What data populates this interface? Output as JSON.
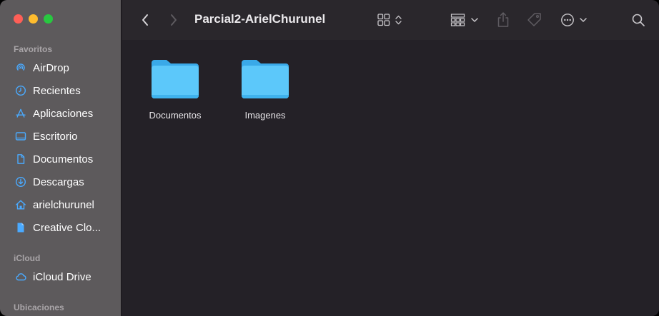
{
  "window": {
    "title": "Parcial2-ArielChurunel"
  },
  "sidebar": {
    "sections": [
      {
        "title": "Favoritos"
      },
      {
        "title": "iCloud"
      },
      {
        "title": "Ubicaciones"
      }
    ],
    "favorites": [
      {
        "label": "AirDrop",
        "icon": "airdrop-icon"
      },
      {
        "label": "Recientes",
        "icon": "clock-icon"
      },
      {
        "label": "Aplicaciones",
        "icon": "applications-icon"
      },
      {
        "label": "Escritorio",
        "icon": "desktop-icon"
      },
      {
        "label": "Documentos",
        "icon": "document-icon"
      },
      {
        "label": "Descargas",
        "icon": "download-icon"
      },
      {
        "label": "arielchurunel",
        "icon": "home-icon"
      },
      {
        "label": "Creative Clo...",
        "icon": "file-icon"
      }
    ],
    "icloud": [
      {
        "label": "iCloud Drive",
        "icon": "cloud-icon"
      }
    ]
  },
  "content": {
    "folders": [
      {
        "label": "Documentos",
        "icon": "folder-icon"
      },
      {
        "label": "Imagenes",
        "icon": "folder-icon"
      }
    ]
  },
  "colors": {
    "accent": "#4aaaff",
    "folder": "#5ac8fa",
    "sidebar_bg": "#5d5a5c",
    "content_bg": "#242127"
  }
}
